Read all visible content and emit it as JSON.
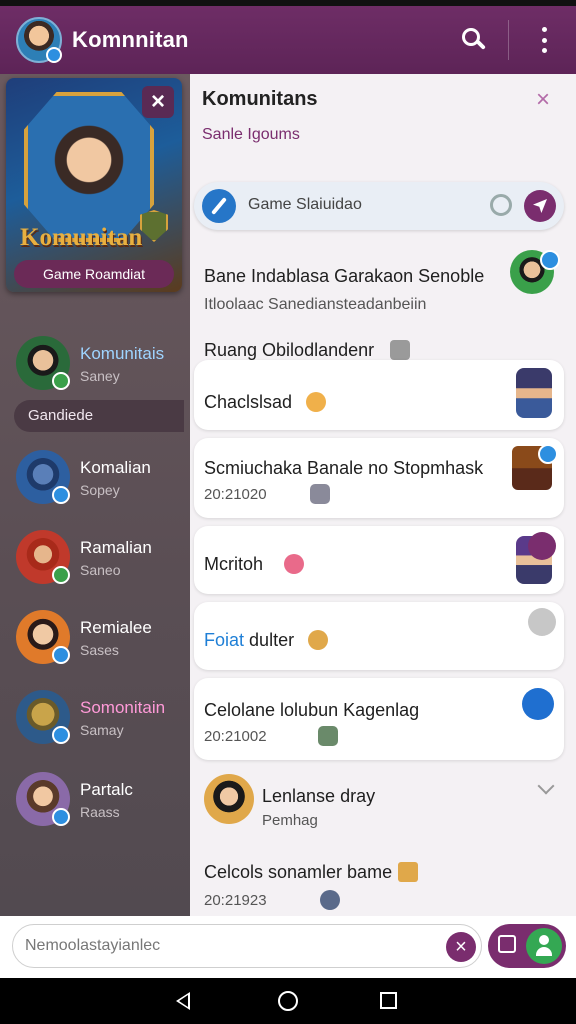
{
  "app": {
    "title": "Komnnitan"
  },
  "sidebar": {
    "hero": {
      "brand": "Komunitan",
      "button_label": "Game Roamdiat"
    },
    "section_label": "Gandiede",
    "items": [
      {
        "name": "Komunitais",
        "sub": "Saney",
        "avatar_color": "#2a6a3a",
        "badge": "green",
        "name_color": "#9fd4ff"
      },
      {
        "name": "Komalian",
        "sub": "Sopey",
        "avatar_color": "#2d5fa0",
        "badge": "blue",
        "name_color": "#ffffff"
      },
      {
        "name": "Ramalian",
        "sub": "Saneo",
        "avatar_color": "#c0392b",
        "badge": "green",
        "name_color": "#ffffff"
      },
      {
        "name": "Remialee",
        "sub": "Sases",
        "avatar_color": "#e07a2a",
        "badge": "blue",
        "name_color": "#ffffff"
      },
      {
        "name": "Somonitain",
        "sub": "Samay",
        "avatar_color": "#2d5a8a",
        "badge": "blue",
        "name_color": "#ff9ad8"
      },
      {
        "name": "Partalc",
        "sub": "Raass",
        "avatar_color": "#8a6aa8",
        "badge": "blue",
        "name_color": "#ffffff"
      }
    ]
  },
  "panel": {
    "title": "Komunitans",
    "subtitle": "Sanle Igoums",
    "search": {
      "placeholder": "Game Slaiuidao"
    },
    "messages": [
      {
        "title": "Bane Indablasa Garakaon Senoble",
        "sub": "Itloolaac Sanediansteadanbeiin"
      },
      {
        "title": "Ruang Obilodlandenr"
      },
      {
        "title": "Chaclslsad"
      },
      {
        "title": "Scmiuchaka Banale no Stopmhask",
        "sub": "20:21020"
      },
      {
        "title": "Mcritoh"
      },
      {
        "title": "Foiat",
        "title_rest": "dulter"
      },
      {
        "title": "Celolane lolubun Kagenlag",
        "sub": "20:21002"
      },
      {
        "title": "Lenlanse dray",
        "sub": "Pemhag"
      },
      {
        "title": "Celcols sonamler bame",
        "sub": "20:21923"
      }
    ]
  },
  "composer": {
    "placeholder": "Nemoolastayianlec"
  },
  "colors": {
    "primary": "#6e2d66",
    "accent": "#2676c8",
    "green": "#34a853"
  }
}
